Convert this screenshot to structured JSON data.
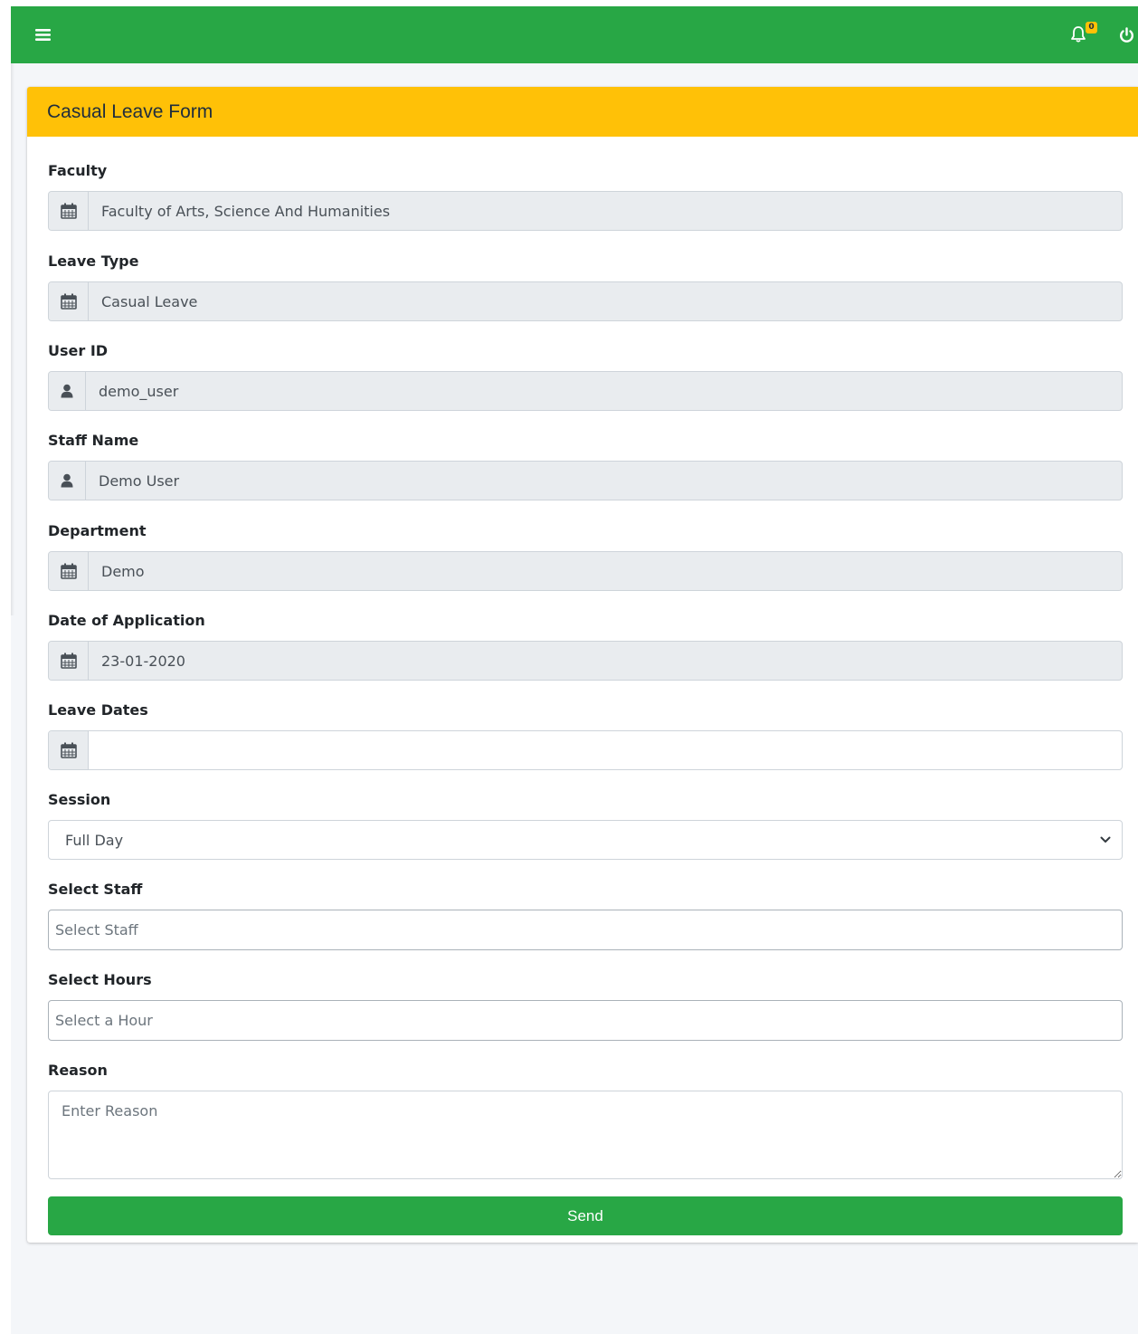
{
  "navbar": {
    "menu_icon": "hamburger-menu-icon",
    "notification_icon": "bell-icon",
    "notification_count": "0",
    "logout_icon": "power-icon",
    "color": "#28a745"
  },
  "card": {
    "title": "Casual Leave Form",
    "header_color": "#ffc107"
  },
  "form": {
    "faculty": {
      "label": "Faculty",
      "value": "Faculty of Arts, Science And Humanities",
      "icon": "calendar-icon"
    },
    "leave_type": {
      "label": "Leave Type",
      "value": "Casual Leave",
      "icon": "calendar-icon"
    },
    "user_id": {
      "label": "User ID",
      "value": "demo_user",
      "icon": "user-icon"
    },
    "staff_name": {
      "label": "Staff Name",
      "value": "Demo User",
      "icon": "user-icon"
    },
    "department": {
      "label": "Department",
      "value": "Demo",
      "icon": "calendar-icon"
    },
    "date_of_application": {
      "label": "Date of Application",
      "value": "23-01-2020",
      "icon": "calendar-icon"
    },
    "leave_dates": {
      "label": "Leave Dates",
      "value": "",
      "icon": "calendar-icon"
    },
    "session": {
      "label": "Session",
      "selected": "Full Day"
    },
    "select_staff": {
      "label": "Select Staff",
      "placeholder": "Select Staff"
    },
    "select_hours": {
      "label": "Select Hours",
      "placeholder": "Select a Hour"
    },
    "reason": {
      "label": "Reason",
      "placeholder": "Enter Reason"
    },
    "send_label": "Send"
  }
}
